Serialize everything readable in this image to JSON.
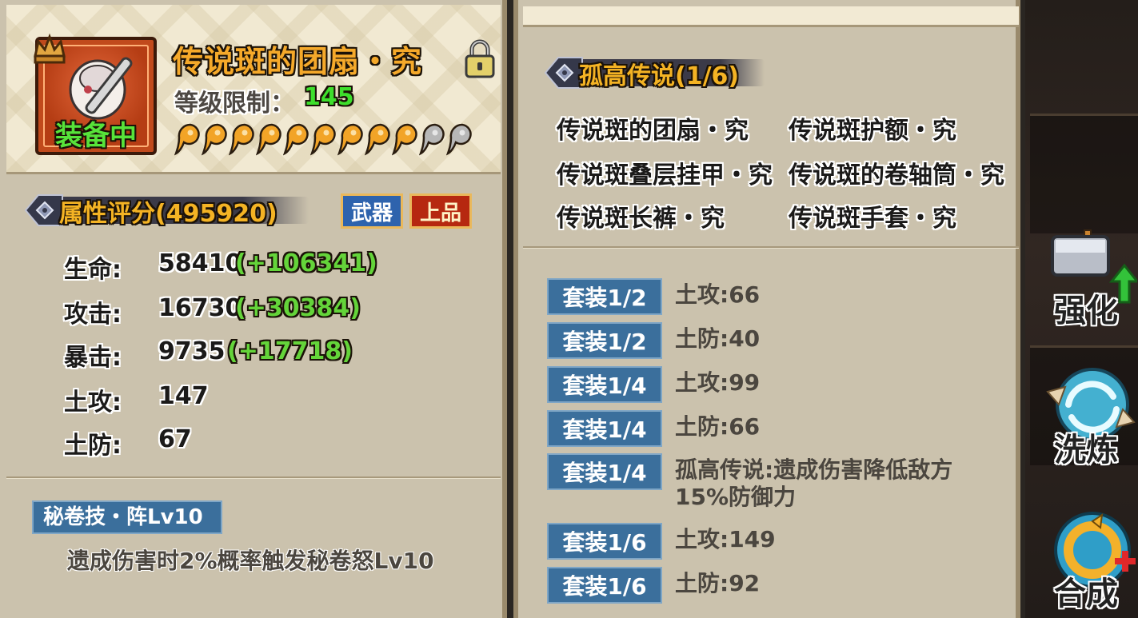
{
  "item": {
    "name": "传说斑的团扇・究",
    "equipped_label": "装备中",
    "level_label": "等级限制：",
    "level_value": "145",
    "magatama_filled": 9,
    "magatama_total": 11,
    "locked": true
  },
  "attributes": {
    "title": "属性评分(495920)",
    "type_badge": "武器",
    "quality_badge": "上品",
    "stats": [
      {
        "label": "生命:",
        "value": "58410",
        "bonus": "(+106341)"
      },
      {
        "label": "攻击:",
        "value": "16730",
        "bonus": "(+30384)"
      },
      {
        "label": "暴击:",
        "value": "9735",
        "bonus": "(+17718)"
      },
      {
        "label": "土攻:",
        "value": "147",
        "bonus": ""
      },
      {
        "label": "土防:",
        "value": "67",
        "bonus": ""
      }
    ]
  },
  "skill": {
    "name": "秘卷技・阵Lv10",
    "description": "遗成伤害时2%概率触发秘卷怒Lv10"
  },
  "set": {
    "title": "孤高传说(1/6)",
    "pieces": [
      "传说斑的团扇・究",
      "传说斑护额・究",
      "传说斑叠层挂甲・究",
      "传说斑的卷轴筒・究",
      "传说斑长裤・究",
      "传说斑手套・究"
    ],
    "bonuses": [
      {
        "badge": "套装1/2",
        "text": "土攻:66"
      },
      {
        "badge": "套装1/2",
        "text": "土防:40"
      },
      {
        "badge": "套装1/4",
        "text": "土攻:99"
      },
      {
        "badge": "套装1/4",
        "text": "土防:66"
      },
      {
        "badge": "套装1/4",
        "text": "孤高传说:遗成伤害降低敌方15%防御力"
      },
      {
        "badge": "套装1/6",
        "text": "土攻:149"
      },
      {
        "badge": "套装1/6",
        "text": "土防:92"
      }
    ]
  },
  "side_menu": {
    "enhance": "强化",
    "refine": "洗炼",
    "synthesize": "合成"
  },
  "colors": {
    "panel_bg": "#cbc2ad",
    "name_orange": "#f5a92a",
    "stat_green": "#64d43a",
    "badge_blue": "#3b6f9c"
  }
}
